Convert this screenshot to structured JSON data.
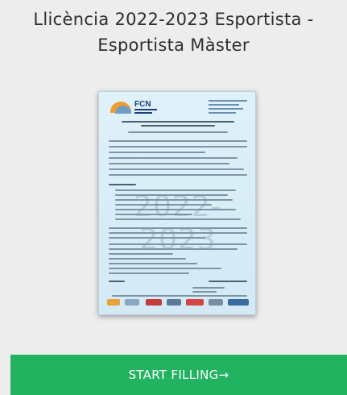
{
  "header": {
    "title_line1": "Llicència 2022-2023 Esportista -",
    "title_line2": "Esportista Màster"
  },
  "document_preview": {
    "logo_text": "FCN",
    "watermark": "2022-2023"
  },
  "cta": {
    "label": "START FILLING→"
  },
  "colors": {
    "cta_background": "#21b35f",
    "page_background": "#ededed",
    "title_text": "#2e2e2e"
  }
}
